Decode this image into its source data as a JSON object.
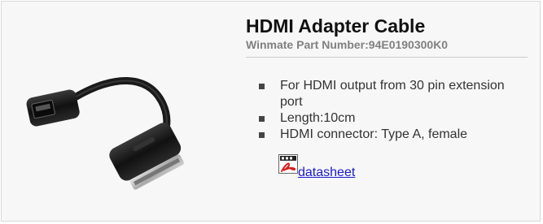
{
  "product": {
    "title": "HDMI Adapter Cable",
    "part_number": "Winmate Part Number:94E0190300K0",
    "features": [
      "For HDMI output from 30 pin extension port",
      "Length:10cm",
      "HDMI connector: Type A, female"
    ],
    "datasheet_label": "datasheet",
    "datasheet_icon": "pdf-icon"
  },
  "colors": {
    "title": "#111111",
    "part_number": "#808080",
    "link": "#1a1acc",
    "card_background": "#f7f7f7"
  }
}
